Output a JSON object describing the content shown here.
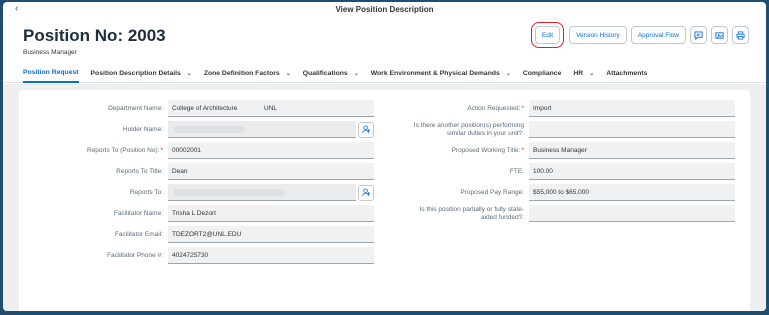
{
  "window": {
    "title": "View Position Description"
  },
  "header": {
    "title": "Position No: 2003",
    "subtitle": "Business Manager"
  },
  "actions": {
    "edit": "Edit",
    "version_history": "Version History",
    "approval_flow": "Approval Flow"
  },
  "tabs": [
    {
      "label": "Position Request",
      "active": true
    },
    {
      "label": "Position Description Details",
      "dropdown": true
    },
    {
      "label": "Zone Definition Factors",
      "dropdown": true
    },
    {
      "label": "Qualifications",
      "dropdown": true
    },
    {
      "label": "Work Environment & Physical Demands",
      "dropdown": true
    },
    {
      "label": "Compliance"
    },
    {
      "label": "HR",
      "dropdown": true
    },
    {
      "label": "Attachments"
    }
  ],
  "left_fields": [
    {
      "label": "Department Name:",
      "value": "College of Architecture",
      "value2": "UNL"
    },
    {
      "label": "Holder Name:",
      "value": ""
    },
    {
      "label": "Reports To (Position No):",
      "value": "00002001",
      "required": "*"
    },
    {
      "label": "Reports To Title:",
      "value": "Dean"
    },
    {
      "label": "Reports To:",
      "value": ""
    },
    {
      "label": "Facilitator Name:",
      "value": "Trisha L Dezort"
    },
    {
      "label": "Facilitator Email:",
      "value": "TDEZORT2@UNL.EDU"
    },
    {
      "label": "Facilitator Phone #:",
      "value": "4024725730"
    }
  ],
  "right_fields": [
    {
      "label": "Action Requested:",
      "value": "Import",
      "required": "*"
    },
    {
      "label1": "Is there another position(s) performing",
      "label2": "similar duties in your unit?:",
      "value": ""
    },
    {
      "label": "Proposed Working Title:",
      "value": "Business Manager",
      "required": "*"
    },
    {
      "label": "FTE:",
      "value": "100.00"
    },
    {
      "label": "Proposed Pay Range:",
      "value": "$55,000 to $65,000"
    },
    {
      "label1": "Is this position partially or fully state-",
      "label2": "aided funded?:",
      "value": ""
    }
  ]
}
